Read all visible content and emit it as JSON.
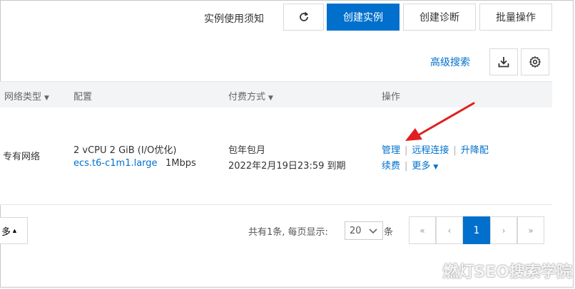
{
  "toolbar": {
    "notice": "实例使用须知",
    "refresh_icon": "refresh-icon",
    "create_instance": "创建实例",
    "create_diagnosis": "创建诊断",
    "batch_operations": "批量操作"
  },
  "search_bar": {
    "advanced_search": "高级搜索",
    "download_icon": "download-icon",
    "settings_icon": "gear-icon"
  },
  "table": {
    "headers": {
      "network_type": "网络类型",
      "config": "配置",
      "billing": "付费方式",
      "actions": "操作"
    },
    "row": {
      "network_type": "专有网络",
      "config_spec": "2 vCPU 2 GiB  (I/O优化)",
      "instance_type": "ecs.t6-c1m1.large",
      "bandwidth": "1Mbps",
      "billing_type": "包年包月",
      "expire": "2022年2月19日23:59 到期",
      "actions": {
        "manage": "管理",
        "remote_connect": "远程连接",
        "upgrade": "升降配",
        "renew": "续费",
        "more": "更多"
      }
    }
  },
  "footer": {
    "more_label": "多",
    "total_text": "共有1条, 每页显示:",
    "page_size": "20",
    "unit": "条",
    "pager": {
      "first": "«",
      "prev": "‹",
      "current": "1",
      "next": "›",
      "last": "»"
    }
  },
  "watermark": "燃灯SEO搜索学院",
  "colors": {
    "primary": "#0070cc",
    "annotation_arrow": "#e02020"
  }
}
